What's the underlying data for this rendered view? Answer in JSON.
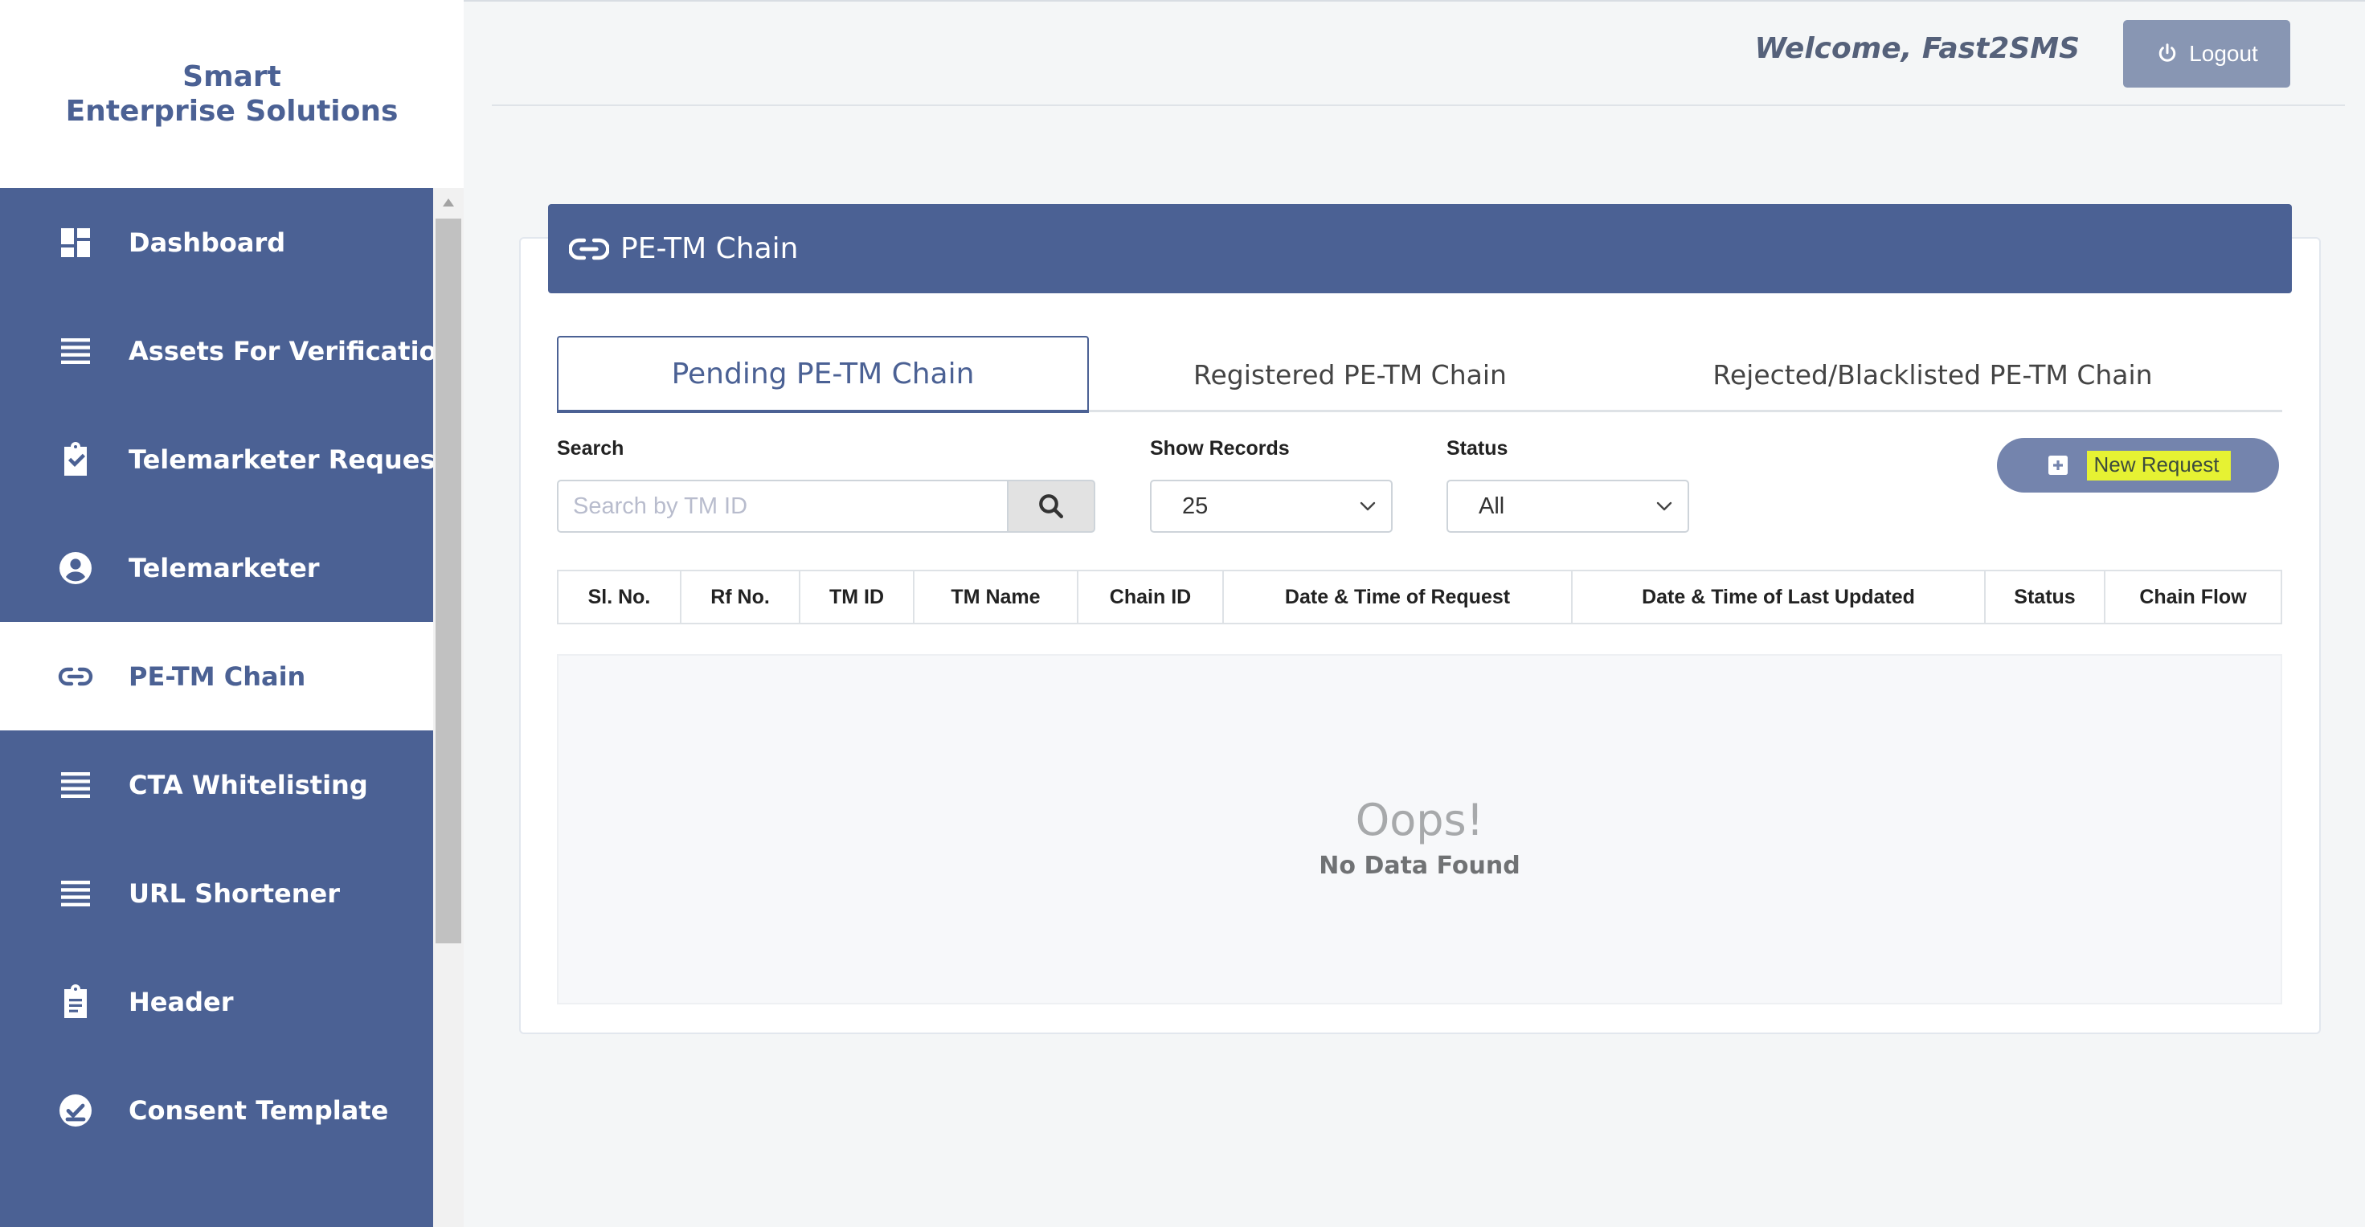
{
  "brand": {
    "line1": "Smart",
    "line2": "Enterprise Solutions"
  },
  "header": {
    "welcome": "Welcome, Fast2SMS",
    "logout_label": "Logout"
  },
  "sidebar": {
    "items": [
      {
        "label": "Dashboard",
        "icon": "dashboard-icon",
        "active": false
      },
      {
        "label": "Assets For Verification",
        "icon": "list-icon",
        "active": false
      },
      {
        "label": "Telemarketer Request",
        "icon": "clipboard-check-icon",
        "active": false
      },
      {
        "label": "Telemarketer",
        "icon": "user-circle-icon",
        "active": false
      },
      {
        "label": "PE-TM Chain",
        "icon": "link-icon",
        "active": true
      },
      {
        "label": "CTA Whitelisting",
        "icon": "list-icon",
        "active": false
      },
      {
        "label": "URL Shortener",
        "icon": "list-icon",
        "active": false
      },
      {
        "label": "Header",
        "icon": "clipboard-text-icon",
        "active": false
      },
      {
        "label": "Consent Template",
        "icon": "check-circle-icon",
        "active": false
      }
    ]
  },
  "card": {
    "title": "PE-TM Chain"
  },
  "tabs": [
    {
      "label": "Pending PE-TM Chain",
      "active": true
    },
    {
      "label": "Registered PE-TM Chain",
      "active": false
    },
    {
      "label": "Rejected/Blacklisted PE-TM Chain",
      "active": false
    }
  ],
  "filters": {
    "search_label": "Search",
    "search_placeholder": "Search by TM ID",
    "show_records_label": "Show Records",
    "show_records_value": "25",
    "status_label": "Status",
    "status_value": "All"
  },
  "new_request_label": "New Request",
  "table": {
    "columns": [
      "Sl. No.",
      "Rf No.",
      "TM ID",
      "TM Name",
      "Chain ID",
      "Date & Time of Request",
      "Date & Time of Last Updated",
      "Status",
      "Chain Flow"
    ]
  },
  "empty": {
    "title": "Oops!",
    "message": "No Data Found"
  },
  "colors": {
    "primary": "#4b6194",
    "button_muted": "#8896b3",
    "highlight": "#e6f233"
  }
}
